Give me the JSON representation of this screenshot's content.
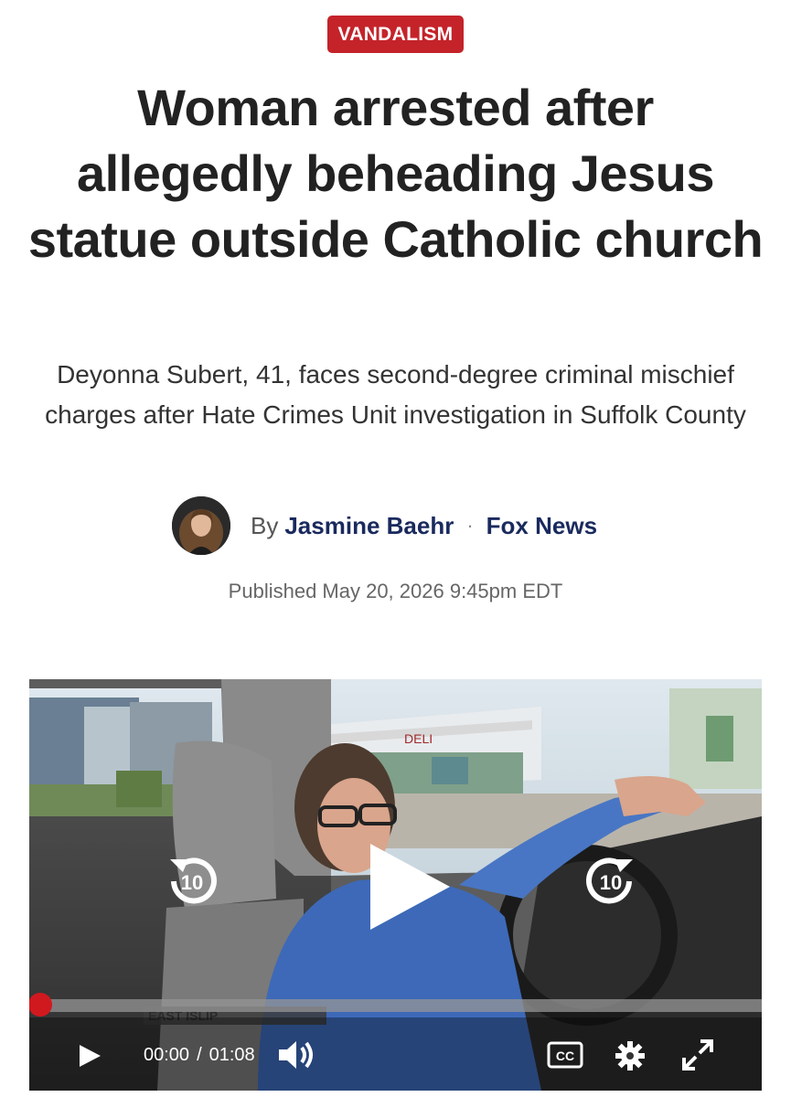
{
  "category": {
    "label": "VANDALISM",
    "color": "#c4232a"
  },
  "headline": "Woman arrested after allegedly beheading Jesus statue outside Catholic church",
  "subheadline": "Deyonna Subert, 41, faces second-degree criminal mischief charges after Hate Crimes Unit investigation in Suffolk County",
  "byline": {
    "prefix": "By",
    "author": "Jasmine Baehr",
    "separator": "·",
    "source": "Fox News",
    "link_color": "#1a2a5e"
  },
  "published": "Published May 20, 2026 9:45pm EDT",
  "video": {
    "sign_text": "DELI",
    "lower_third_text": "EAST ISLIP",
    "player": {
      "current_time": "00:00",
      "time_separator": "/",
      "duration": "01:08",
      "progress_fraction": 0,
      "rewind_seconds": "10",
      "forward_seconds": "10",
      "cc_label": "CC",
      "progress_color": "#d0191f"
    },
    "icons": {
      "rewind": "rewind-10-icon",
      "play_big": "play-icon",
      "forward": "forward-10-icon",
      "play": "play-icon",
      "volume": "volume-icon",
      "captions": "closed-captions-icon",
      "settings": "gear-icon",
      "fullscreen": "fullscreen-icon"
    }
  }
}
